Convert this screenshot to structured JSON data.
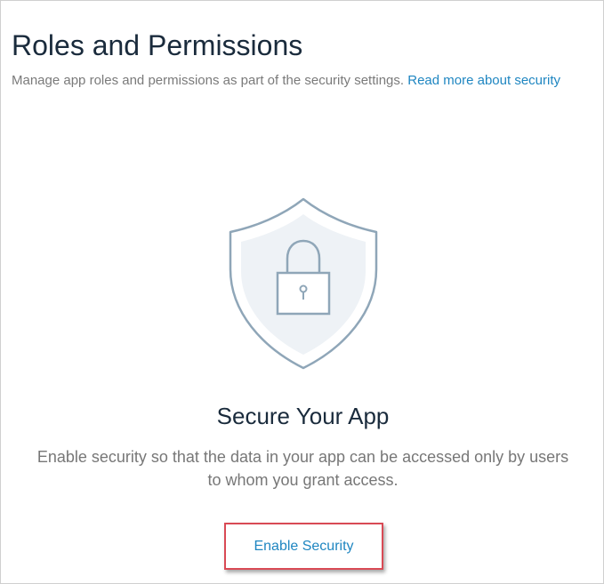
{
  "header": {
    "title": "Roles and Permissions",
    "subtitle": "Manage app roles and permissions as part of the security settings.",
    "link_label": "Read more about security"
  },
  "empty_state": {
    "illustration_icon": "shield-lock-icon",
    "heading": "Secure Your App",
    "description": "Enable security so that the data in your app can be accessed only by users to whom you grant access.",
    "button_label": "Enable Security"
  },
  "colors": {
    "link": "#1f86c1",
    "highlight": "#d94a55",
    "shield_stroke": "#8fa6b8",
    "shield_fill": "#eef2f6"
  }
}
